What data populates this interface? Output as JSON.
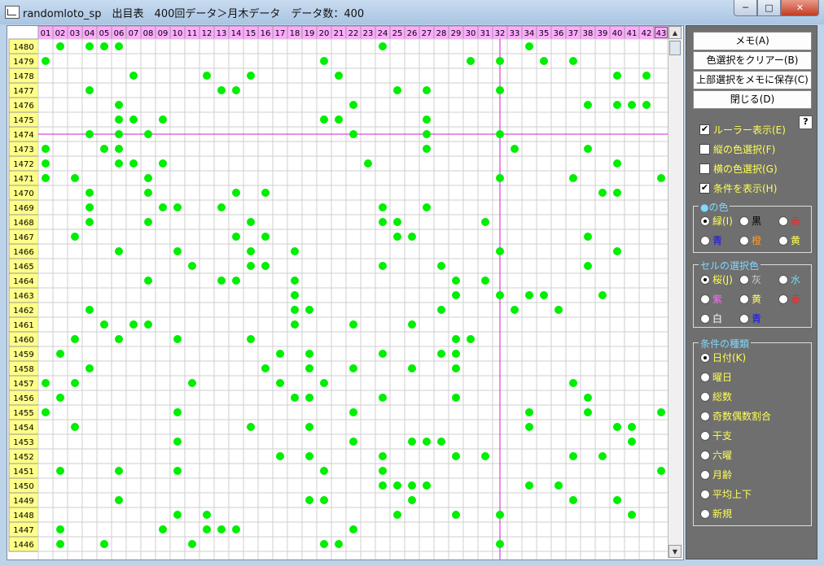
{
  "window": {
    "title": "randomloto_sp　出目表　400回データ＞月木データ　データ数：400",
    "minimize_icon": "minimize-icon",
    "maximize_icon": "maximize-icon",
    "close_icon": "close-icon"
  },
  "grid": {
    "columns": [
      "01",
      "02",
      "03",
      "04",
      "05",
      "06",
      "07",
      "08",
      "09",
      "10",
      "11",
      "12",
      "13",
      "14",
      "15",
      "16",
      "17",
      "18",
      "19",
      "20",
      "21",
      "22",
      "23",
      "24",
      "25",
      "26",
      "27",
      "28",
      "29",
      "30",
      "31",
      "32",
      "33",
      "34",
      "35",
      "36",
      "37",
      "38",
      "39",
      "40",
      "41",
      "42",
      "43"
    ],
    "rows": [
      {
        "draw": "1480",
        "hits": [
          2,
          4,
          5,
          6,
          24,
          34
        ]
      },
      {
        "draw": "1479",
        "hits": [
          1,
          20,
          30,
          32,
          35,
          37
        ]
      },
      {
        "draw": "1478",
        "hits": [
          7,
          12,
          15,
          21,
          40,
          42
        ]
      },
      {
        "draw": "1477",
        "hits": [
          4,
          13,
          14,
          25,
          27,
          32
        ]
      },
      {
        "draw": "1476",
        "hits": [
          6,
          22,
          38,
          40,
          41,
          42
        ]
      },
      {
        "draw": "1475",
        "hits": [
          6,
          7,
          9,
          20,
          21,
          27
        ]
      },
      {
        "draw": "1474",
        "hits": [
          4,
          6,
          8,
          22,
          27,
          32
        ]
      },
      {
        "draw": "1473",
        "hits": [
          1,
          5,
          6,
          27,
          33,
          38
        ]
      },
      {
        "draw": "1472",
        "hits": [
          1,
          6,
          7,
          9,
          23,
          40
        ]
      },
      {
        "draw": "1471",
        "hits": [
          1,
          3,
          8,
          32,
          37,
          43
        ]
      },
      {
        "draw": "1470",
        "hits": [
          4,
          8,
          14,
          16,
          39,
          40
        ]
      },
      {
        "draw": "1469",
        "hits": [
          4,
          9,
          10,
          13,
          24,
          27
        ]
      },
      {
        "draw": "1468",
        "hits": [
          4,
          8,
          15,
          24,
          25,
          31
        ]
      },
      {
        "draw": "1467",
        "hits": [
          3,
          14,
          16,
          25,
          26,
          38
        ]
      },
      {
        "draw": "1466",
        "hits": [
          6,
          10,
          15,
          18,
          32,
          40
        ]
      },
      {
        "draw": "1465",
        "hits": [
          11,
          15,
          16,
          24,
          28,
          38
        ]
      },
      {
        "draw": "1464",
        "hits": [
          8,
          13,
          14,
          18,
          29,
          31
        ]
      },
      {
        "draw": "1463",
        "hits": [
          18,
          29,
          32,
          34,
          35,
          39
        ]
      },
      {
        "draw": "1462",
        "hits": [
          4,
          18,
          19,
          28,
          33,
          36
        ]
      },
      {
        "draw": "1461",
        "hits": [
          5,
          7,
          8,
          18,
          22,
          26
        ]
      },
      {
        "draw": "1460",
        "hits": [
          3,
          6,
          10,
          15,
          29,
          30
        ]
      },
      {
        "draw": "1459",
        "hits": [
          2,
          17,
          19,
          24,
          28,
          29
        ]
      },
      {
        "draw": "1458",
        "hits": [
          4,
          16,
          19,
          22,
          26,
          29
        ]
      },
      {
        "draw": "1457",
        "hits": [
          1,
          3,
          11,
          17,
          20,
          37
        ]
      },
      {
        "draw": "1456",
        "hits": [
          2,
          18,
          19,
          24,
          29,
          38
        ]
      },
      {
        "draw": "1455",
        "hits": [
          1,
          10,
          22,
          34,
          38,
          43
        ]
      },
      {
        "draw": "1454",
        "hits": [
          3,
          15,
          19,
          34,
          40,
          41
        ]
      },
      {
        "draw": "1453",
        "hits": [
          10,
          22,
          26,
          27,
          28,
          41
        ]
      },
      {
        "draw": "1452",
        "hits": [
          17,
          19,
          24,
          29,
          31,
          37,
          39
        ]
      },
      {
        "draw": "1451",
        "hits": [
          2,
          6,
          10,
          20,
          24,
          43
        ]
      },
      {
        "draw": "1450",
        "hits": [
          24,
          25,
          26,
          27,
          34,
          36
        ]
      },
      {
        "draw": "1449",
        "hits": [
          6,
          19,
          20,
          26,
          37,
          40
        ]
      },
      {
        "draw": "1448",
        "hits": [
          10,
          12,
          25,
          29,
          32,
          41
        ]
      },
      {
        "draw": "1447",
        "hits": [
          2,
          9,
          12,
          13,
          14,
          22
        ]
      },
      {
        "draw": "1446",
        "hits": [
          2,
          5,
          11,
          20,
          21,
          32
        ]
      }
    ],
    "ruler_row": "1474",
    "ruler_column": "32",
    "dot_color": "#00ee00",
    "ruler_color": "#d020d0",
    "header_bg": "#ffaaff",
    "row_header_bg": "#ffff88"
  },
  "panel": {
    "buttons": [
      "メモ(A)",
      "色選択をクリアー(B)",
      "上部選択をメモに保存(C)",
      "閉じる(D)"
    ],
    "help": "?",
    "checkboxes": [
      {
        "label": "ルーラー表示(E)",
        "checked": true
      },
      {
        "label": "縦の色選択(F)",
        "checked": false
      },
      {
        "label": "横の色選択(G)",
        "checked": false
      },
      {
        "label": "条件を表示(H)",
        "checked": true
      }
    ],
    "dot_color_group": {
      "title": "●の色",
      "options": [
        {
          "label": "緑(I)",
          "color": "#ffff55",
          "selected": true
        },
        {
          "label": "黒",
          "color": "#000000",
          "selected": false
        },
        {
          "label": "赤",
          "color": "#ff2020",
          "selected": false
        },
        {
          "label": "青",
          "color": "#1010ff",
          "selected": false
        },
        {
          "label": "橙",
          "color": "#ff9a20",
          "selected": false
        },
        {
          "label": "黄",
          "color": "#ffff55",
          "selected": false
        }
      ]
    },
    "cell_color_group": {
      "title": "セルの選択色",
      "options": [
        {
          "label": "桜(J)",
          "color": "#ffff55",
          "selected": true
        },
        {
          "label": "灰",
          "color": "#cccccc",
          "selected": false
        },
        {
          "label": "水",
          "color": "#66ddff",
          "selected": false
        },
        {
          "label": "紫",
          "color": "#ff66ff",
          "selected": false
        },
        {
          "label": "黄",
          "color": "#ffff55",
          "selected": false
        },
        {
          "label": "赤",
          "color": "#ff2020",
          "selected": false
        },
        {
          "label": "白",
          "color": "#ffffff",
          "selected": false
        },
        {
          "label": "青",
          "color": "#1010ff",
          "selected": false
        }
      ]
    },
    "condition_group": {
      "title": "条件の種類",
      "options": [
        {
          "label": "日付(K)",
          "selected": true
        },
        {
          "label": "曜日",
          "selected": false
        },
        {
          "label": "総数",
          "selected": false
        },
        {
          "label": "奇数偶数割合",
          "selected": false
        },
        {
          "label": "干支",
          "selected": false
        },
        {
          "label": "六曜",
          "selected": false
        },
        {
          "label": "月齢",
          "selected": false
        },
        {
          "label": "平均上下",
          "selected": false
        },
        {
          "label": "新規",
          "selected": false
        }
      ]
    }
  }
}
